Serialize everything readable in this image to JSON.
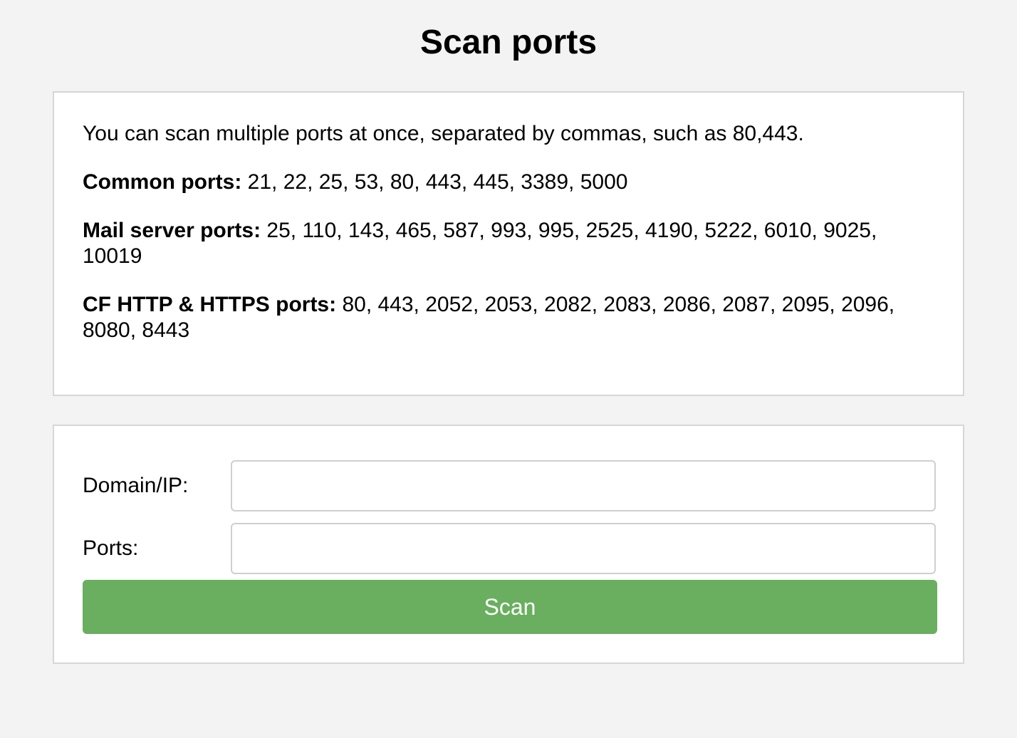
{
  "page": {
    "title": "Scan ports"
  },
  "info": {
    "intro": "You can scan multiple ports at once, separated by commas, such as 80,443.",
    "common_label": "Common ports:",
    "common_ports": " 21, 22, 25, 53, 80, 443, 445, 3389, 5000",
    "mail_label": "Mail server ports:",
    "mail_ports": " 25, 110, 143, 465, 587, 993, 995, 2525, 4190, 5222, 6010, 9025, 10019",
    "cf_label": "CF HTTP & HTTPS ports:",
    "cf_ports": " 80, 443, 2052, 2053, 2082, 2083, 2086, 2087, 2095, 2096, 8080, 8443"
  },
  "form": {
    "domain_label": "Domain/IP:",
    "domain_value": "",
    "ports_label": "Ports:",
    "ports_value": "",
    "scan_label": "Scan"
  },
  "colors": {
    "background": "#f3f3f3",
    "card": "#ffffff",
    "button": "#69af5f",
    "button_text": "#ffffff"
  }
}
